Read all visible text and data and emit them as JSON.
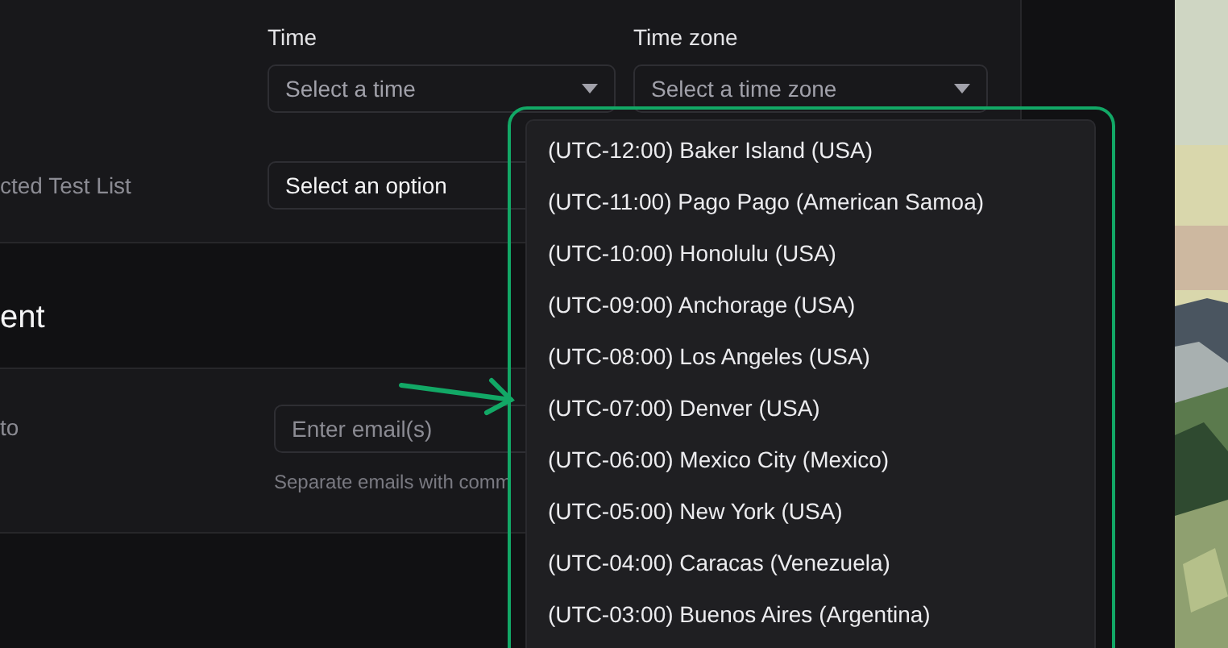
{
  "schedule": {
    "time": {
      "label": "Time",
      "placeholder": "Select a time"
    },
    "time_zone": {
      "label": "Time zone",
      "placeholder": "Select a time zone"
    },
    "test_list": {
      "label": "cted Test List",
      "value": "Select an option"
    }
  },
  "notification": {
    "heading": "ent",
    "recipient_label": "to",
    "email": {
      "placeholder": "Enter email(s)"
    },
    "helper": "Separate emails with comm"
  },
  "time_zone_options": [
    {
      "label": "(UTC-12:00) Baker Island (USA)",
      "selected": false
    },
    {
      "label": "(UTC-11:00) Pago Pago (American Samoa)",
      "selected": false
    },
    {
      "label": "(UTC-10:00) Honolulu (USA)",
      "selected": false
    },
    {
      "label": "(UTC-09:00) Anchorage (USA)",
      "selected": false
    },
    {
      "label": "(UTC-08:00) Los Angeles (USA)",
      "selected": false
    },
    {
      "label": "(UTC-07:00) Denver (USA)",
      "selected": false
    },
    {
      "label": "(UTC-06:00) Mexico City (Mexico)",
      "selected": false
    },
    {
      "label": "(UTC-05:00) New York (USA)",
      "selected": false
    },
    {
      "label": "(UTC-04:00) Caracas (Venezuela)",
      "selected": false
    },
    {
      "label": "(UTC-03:00) Buenos Aires (Argentina)",
      "selected": false
    }
  ]
}
